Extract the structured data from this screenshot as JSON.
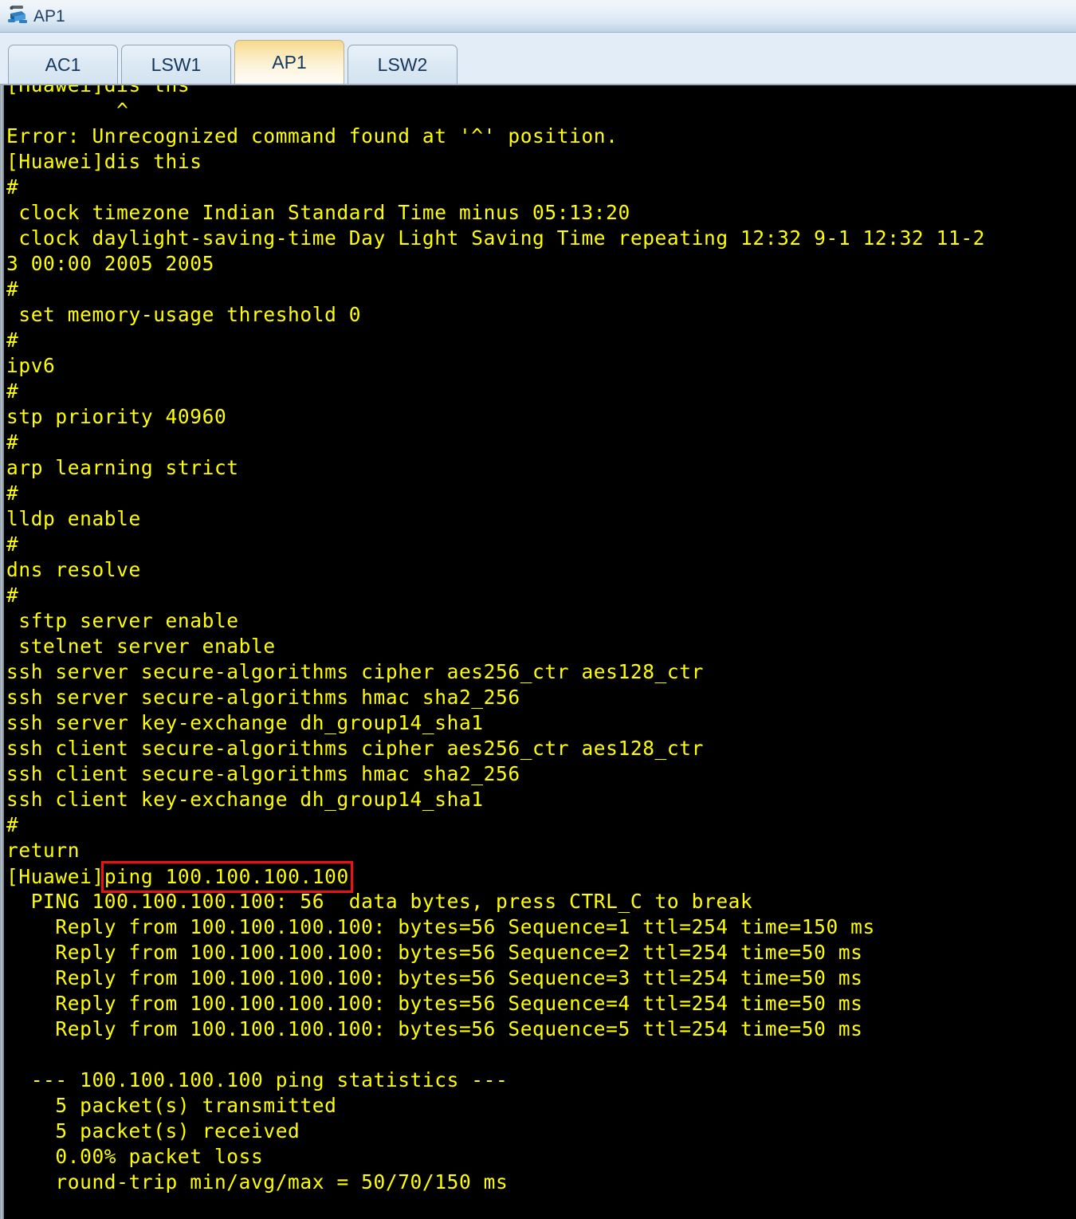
{
  "window": {
    "title": "AP1",
    "icon": "router-device-icon"
  },
  "tabs": [
    {
      "label": "AC1",
      "active": false
    },
    {
      "label": "LSW1",
      "active": false
    },
    {
      "label": "AP1",
      "active": true
    },
    {
      "label": "LSW2",
      "active": false
    }
  ],
  "colors": {
    "terminal_bg": "#000000",
    "terminal_fg": "#ffff00",
    "highlight_box": "#ee1111",
    "active_tab_top": "#f6d88b",
    "titlebar_text": "#1f3f66"
  },
  "terminal": {
    "clipped_first_line": "[Huawei]dis ths",
    "lines": [
      "         ^",
      "Error: Unrecognized command found at '^' position.",
      "[Huawei]dis this",
      "#",
      " clock timezone Indian Standard Time minus 05:13:20",
      " clock daylight-saving-time Day Light Saving Time repeating 12:32 9-1 12:32 11-2",
      "3 00:00 2005 2005",
      "#",
      " set memory-usage threshold 0",
      "#",
      "ipv6",
      "#",
      "stp priority 40960",
      "#",
      "arp learning strict",
      "#",
      "lldp enable",
      "#",
      "dns resolve",
      "#",
      " sftp server enable",
      " stelnet server enable",
      "ssh server secure-algorithms cipher aes256_ctr aes128_ctr",
      "ssh server secure-algorithms hmac sha2_256",
      "ssh server key-exchange dh_group14_sha1",
      "ssh client secure-algorithms cipher aes256_ctr aes128_ctr",
      "ssh client secure-algorithms hmac sha2_256",
      "ssh client key-exchange dh_group14_sha1",
      "#",
      "return"
    ],
    "prompt_line": {
      "prompt": "[Huawei]",
      "command": "ping 100.100.100.100",
      "highlighted": true
    },
    "ping_output": [
      "  PING 100.100.100.100: 56  data bytes, press CTRL_C to break",
      "    Reply from 100.100.100.100: bytes=56 Sequence=1 ttl=254 time=150 ms",
      "    Reply from 100.100.100.100: bytes=56 Sequence=2 ttl=254 time=50 ms",
      "    Reply from 100.100.100.100: bytes=56 Sequence=3 ttl=254 time=50 ms",
      "    Reply from 100.100.100.100: bytes=56 Sequence=4 ttl=254 time=50 ms",
      "    Reply from 100.100.100.100: bytes=56 Sequence=5 ttl=254 time=50 ms",
      "",
      "  --- 100.100.100.100 ping statistics ---",
      "    5 packet(s) transmitted",
      "    5 packet(s) received",
      "    0.00% packet loss",
      "    round-trip min/avg/max = 50/70/150 ms"
    ]
  }
}
